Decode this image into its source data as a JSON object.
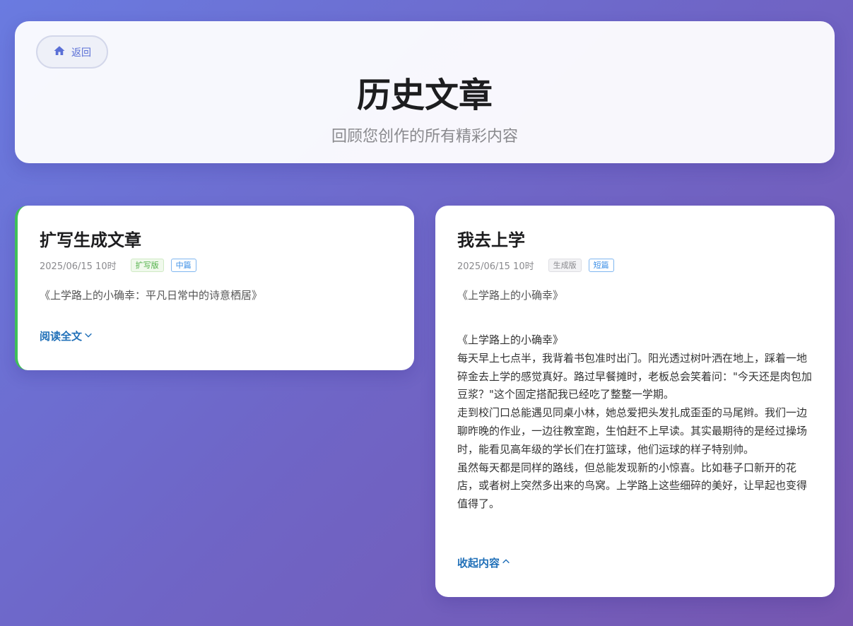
{
  "header": {
    "back_label": "返回",
    "back_icon": "home-icon",
    "title": "历史文章",
    "subtitle": "回顾您创作的所有精彩内容"
  },
  "articles": [
    {
      "title": "扩写生成文章",
      "date": "2025/06/15 10时",
      "tags": [
        "扩写版",
        "中篇"
      ],
      "summary": "《上学路上的小确幸：平凡日常中的诗意栖居》",
      "toggle_label": "阅读全文",
      "toggle_icon": "chevron-down-icon",
      "accent": "#3fbf5a"
    },
    {
      "title": "我去上学",
      "date": "2025/06/15 10时",
      "tags": [
        "生成版",
        "短篇"
      ],
      "summary": "《上学路上的小确幸》",
      "body": [
        "《上学路上的小确幸》",
        "每天早上七点半，我背着书包准时出门。阳光透过树叶洒在地上，踩着一地碎金去上学的感觉真好。路过早餐摊时，老板总会笑着问：\"今天还是肉包加豆浆？\"这个固定搭配我已经吃了整整一学期。",
        "走到校门口总能遇见同桌小林，她总爱把头发扎成歪歪的马尾辫。我们一边聊昨晚的作业，一边往教室跑，生怕赶不上早读。其实最期待的是经过操场时，能看见高年级的学长们在打篮球，他们运球的样子特别帅。",
        "虽然每天都是同样的路线，但总能发现新的小惊喜。比如巷子口新开的花店，或者树上突然多出来的鸟窝。上学路上这些细碎的美好，让早起也变得值得了。"
      ],
      "toggle_label": "收起内容",
      "toggle_icon": "chevron-up-icon"
    }
  ],
  "colors": {
    "link": "#1f6fb8",
    "back": "#5a6fd6"
  }
}
